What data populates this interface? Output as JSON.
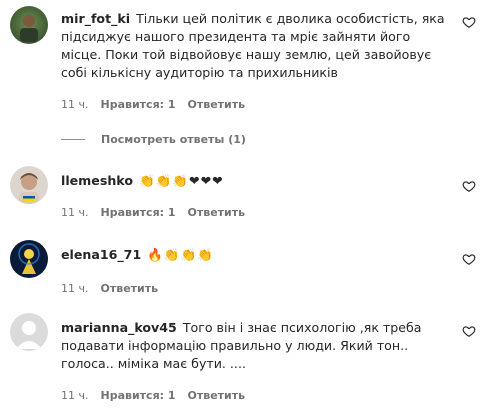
{
  "comments": [
    {
      "user": "mir_fot_ki",
      "text": "Тільки цей політик є дволика особистість, яка підсиджує нашого президента та мріє зайняти його місце. Поки той відвойовує нашу землю, цей завойовує собі кількісну аудиторію та прихильників",
      "time": "11 ч.",
      "likes": "Нравится: 1",
      "reply": "Ответить"
    },
    {
      "user": "llemeshko",
      "emoji": "👏👏👏❤❤❤",
      "time": "11 ч.",
      "likes": "Нравится: 1",
      "reply": "Ответить"
    },
    {
      "user": "elena16_71",
      "emoji": "🔥👏👏👏",
      "time": "11 ч.",
      "reply": "Ответить"
    },
    {
      "user": "marianna_kov45",
      "text": "Того він і знає психологію ,як треба подавати інформацію правильно у люди. Який тон.. голоса.. міміка має бути. ....",
      "time": "11 ч.",
      "likes": "Нравится: 1",
      "reply": "Ответить"
    }
  ],
  "view_replies": "Посмотреть ответы (1)",
  "colors": {
    "text": "#262626",
    "meta": "#737373"
  },
  "icons": [
    "heart-outline-icon"
  ]
}
